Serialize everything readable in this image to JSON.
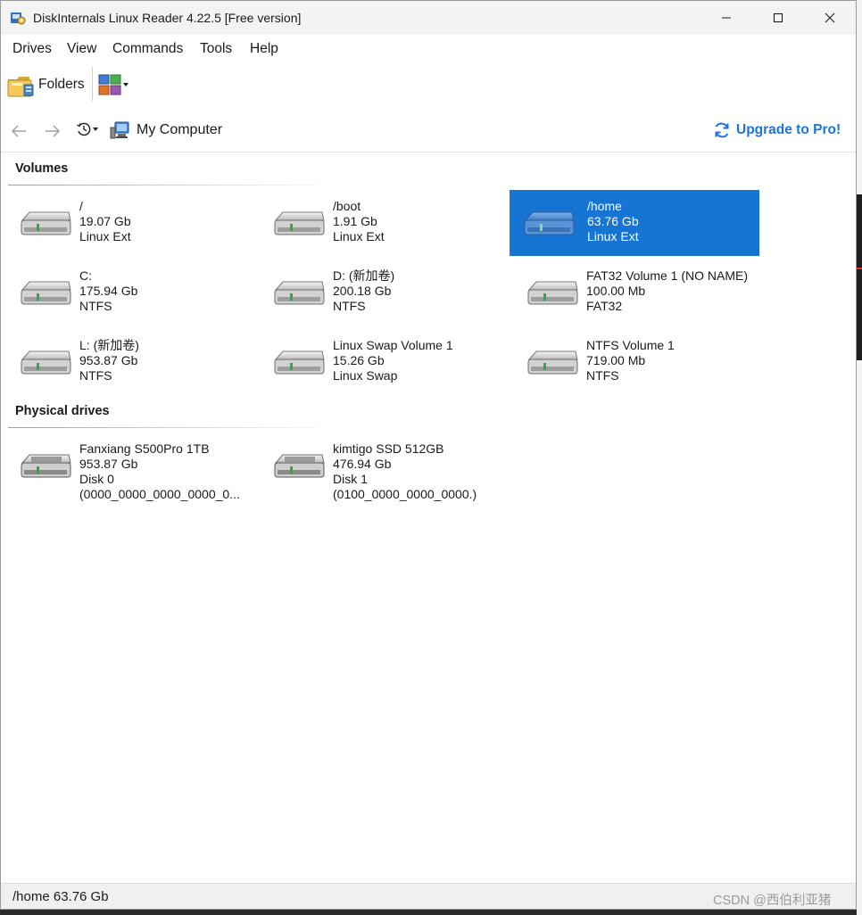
{
  "window": {
    "title": "DiskInternals Linux Reader 4.22.5 [Free version]"
  },
  "menu": [
    "Drives",
    "View",
    "Commands",
    "Tools",
    "Help"
  ],
  "toolbar": {
    "folders_label": "Folders"
  },
  "navigation": {
    "location": "My Computer",
    "upgrade_label": "Upgrade to Pro!"
  },
  "colors": {
    "accent": "#1675d2",
    "upgrade_link": "#1e74d6"
  },
  "sections": {
    "volumes": "Volumes",
    "physical": "Physical drives"
  },
  "volumes": [
    {
      "name": "/",
      "size": "19.07 Gb",
      "fs": "Linux Ext",
      "selected": false
    },
    {
      "name": "/boot",
      "size": "1.91 Gb",
      "fs": "Linux Ext",
      "selected": false
    },
    {
      "name": "/home",
      "size": "63.76 Gb",
      "fs": "Linux Ext",
      "selected": true
    },
    {
      "name": "C:",
      "size": "175.94 Gb",
      "fs": "NTFS",
      "selected": false
    },
    {
      "name": "D: (新加卷)",
      "size": "200.18 Gb",
      "fs": "NTFS",
      "selected": false
    },
    {
      "name": "FAT32 Volume 1 (NO NAME)",
      "size": "100.00 Mb",
      "fs": "FAT32",
      "selected": false
    },
    {
      "name": "L: (新加卷)",
      "size": "953.87 Gb",
      "fs": "NTFS",
      "selected": false
    },
    {
      "name": "Linux Swap Volume 1",
      "size": "15.26 Gb",
      "fs": "Linux Swap",
      "selected": false
    },
    {
      "name": "NTFS Volume 1",
      "size": "719.00 Mb",
      "fs": "NTFS",
      "selected": false
    }
  ],
  "physical_drives": [
    {
      "name": "Fanxiang S500Pro 1TB",
      "size": "953.87 Gb",
      "disk": "Disk 0",
      "serial": "(0000_0000_0000_0000_0..."
    },
    {
      "name": "kimtigo SSD 512GB",
      "size": "476.94 Gb",
      "disk": "Disk 1",
      "serial": "(0100_0000_0000_0000.)"
    }
  ],
  "status": {
    "text": "/home 63.76 Gb",
    "watermark": "CSDN @西伯利亚猪"
  }
}
